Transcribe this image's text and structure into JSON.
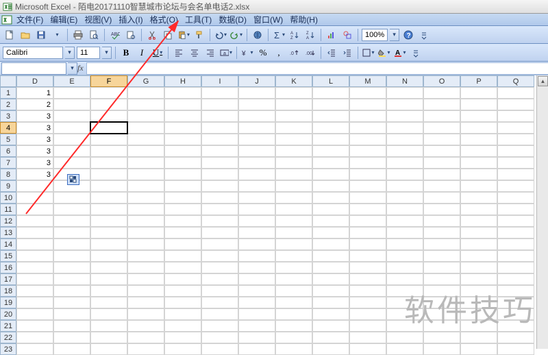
{
  "title": {
    "app": "Microsoft Excel",
    "sep": " - ",
    "doc": "陌电20171110智慧城市论坛与会名单电话2.xlsx"
  },
  "menu": {
    "file": "文件(F)",
    "edit": "编辑(E)",
    "view": "视图(V)",
    "insert": "插入(I)",
    "format": "格式(O)",
    "tools": "工具(T)",
    "data": "数据(D)",
    "window": "窗口(W)",
    "help": "帮助(H)"
  },
  "toolbar": {
    "zoom": "100%"
  },
  "format_bar": {
    "font": "Calibri",
    "size": "11"
  },
  "namebox": {
    "ref": "",
    "fx": "fx"
  },
  "columns": [
    "D",
    "E",
    "F",
    "G",
    "H",
    "I",
    "J",
    "K",
    "L",
    "M",
    "N",
    "O",
    "P",
    "Q"
  ],
  "rows_count": 23,
  "selected": {
    "col": "F",
    "row": 4,
    "col_index": 2,
    "row_index": 3
  },
  "cells": {
    "D1": "1",
    "D2": "2",
    "D3": "3",
    "D4": "3",
    "D5": "3",
    "D6": "3",
    "D7": "3",
    "D8": "3"
  },
  "watermark": "软件技巧"
}
